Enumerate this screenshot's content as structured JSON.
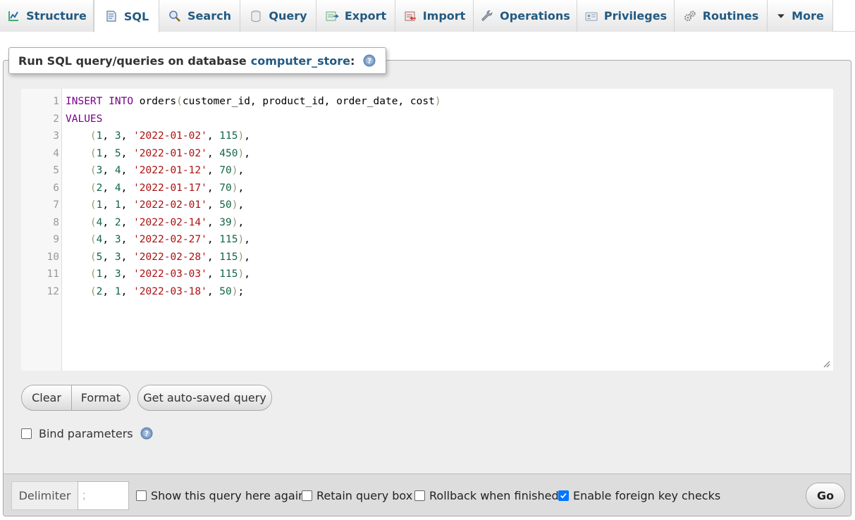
{
  "tabs": [
    {
      "label": "Structure",
      "icon": "structure-icon"
    },
    {
      "label": "SQL",
      "icon": "sql-icon",
      "active": true
    },
    {
      "label": "Search",
      "icon": "search-icon"
    },
    {
      "label": "Query",
      "icon": "query-icon"
    },
    {
      "label": "Export",
      "icon": "export-icon"
    },
    {
      "label": "Import",
      "icon": "import-icon"
    },
    {
      "label": "Operations",
      "icon": "wrench-icon"
    },
    {
      "label": "Privileges",
      "icon": "privileges-icon"
    },
    {
      "label": "Routines",
      "icon": "routines-icon"
    },
    {
      "label": "More",
      "icon": "triangle-down-icon"
    }
  ],
  "legend": {
    "prefix": "Run SQL query/queries on database",
    "database": "computer_store",
    "suffix": ":"
  },
  "editor": {
    "lines": [
      {
        "num": "1",
        "text": "INSERT INTO orders(customer_id, product_id, order_date, cost)"
      },
      {
        "num": "2",
        "text": "VALUES"
      },
      {
        "num": "3",
        "text": "    (1, 3, '2022-01-02', 115),"
      },
      {
        "num": "4",
        "text": "    (1, 5, '2022-01-02', 450),"
      },
      {
        "num": "5",
        "text": "    (3, 4, '2022-01-12', 70),"
      },
      {
        "num": "6",
        "text": "    (2, 4, '2022-01-17', 70),"
      },
      {
        "num": "7",
        "text": "    (1, 1, '2022-02-01', 50),"
      },
      {
        "num": "8",
        "text": "    (4, 2, '2022-02-14', 39),"
      },
      {
        "num": "9",
        "text": "    (4, 3, '2022-02-27', 115),"
      },
      {
        "num": "10",
        "text": "    (5, 3, '2022-02-28', 115),"
      },
      {
        "num": "11",
        "text": "    (1, 3, '2022-03-03', 115),"
      },
      {
        "num": "12",
        "text": "    (2, 1, '2022-03-18', 50);"
      }
    ]
  },
  "buttons": {
    "clear": "Clear",
    "format": "Format",
    "autosaved": "Get auto-saved query"
  },
  "bind_parameters": {
    "label": "Bind parameters",
    "checked": false
  },
  "footer": {
    "delimiter_label": "Delimiter",
    "delimiter_value": ";",
    "options": [
      {
        "label": "Show this query here again",
        "checked": false
      },
      {
        "label": "Retain query box",
        "checked": false
      },
      {
        "label": "Rollback when finished",
        "checked": false
      },
      {
        "label": "Enable foreign key checks",
        "checked": true
      }
    ],
    "go_label": "Go"
  },
  "colors": {
    "link": "#235a81",
    "keyword": "#770088",
    "string": "#aa1111",
    "number": "#116644",
    "checkbox_checked": "#0075ff"
  }
}
